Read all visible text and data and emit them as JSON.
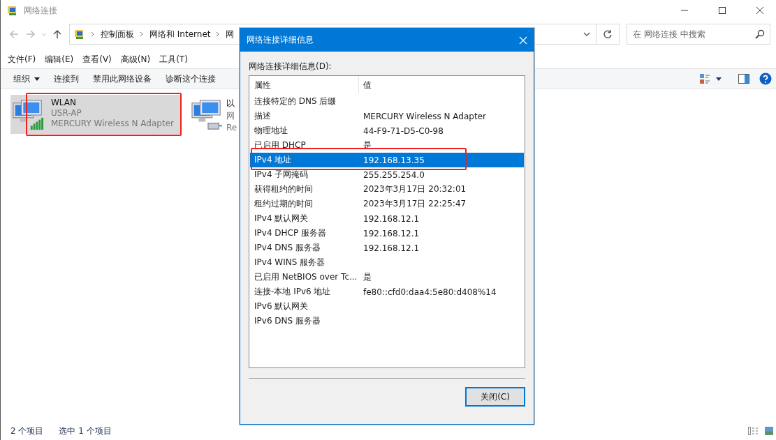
{
  "window": {
    "title": "网络连接"
  },
  "address_bar": {
    "crumbs": [
      "控制面板",
      "网络和 Internet",
      "网"
    ]
  },
  "search": {
    "placeholder": "在 网络连接 中搜索"
  },
  "menu_bar": [
    "文件(F)",
    "编辑(E)",
    "查看(V)",
    "高级(N)",
    "工具(T)"
  ],
  "command_bar": [
    {
      "label": "组织",
      "kind": "dropdown"
    },
    {
      "label": "连接到",
      "kind": "plain"
    },
    {
      "label": "禁用此网络设备",
      "kind": "plain"
    },
    {
      "label": "诊断这个连接",
      "kind": "plain"
    }
  ],
  "adapters": [
    {
      "kind": "wireless",
      "name": "WLAN",
      "network": "USR-AP",
      "device": "MERCURY Wireless N Adapter",
      "selected": true,
      "highlighted": true
    },
    {
      "kind": "ethernet",
      "name": "以",
      "network": "网",
      "device": "Re",
      "selected": false,
      "highlighted": false
    }
  ],
  "status_bar": {
    "count": "2 个项目",
    "selection": "选中 1 个项目"
  },
  "dialog": {
    "title": "网络连接详细信息",
    "list_label": "网络连接详细信息(D):",
    "columns": [
      "属性",
      "值"
    ],
    "rows": [
      {
        "property": "连接特定的 DNS 后缀",
        "value": "",
        "selected": false,
        "highlighted": false
      },
      {
        "property": "描述",
        "value": "MERCURY Wireless N Adapter",
        "selected": false,
        "highlighted": false
      },
      {
        "property": "物理地址",
        "value": "44-F9-71-D5-C0-98",
        "selected": false,
        "highlighted": false
      },
      {
        "property": "已启用 DHCP",
        "value": "是",
        "selected": false,
        "highlighted": false
      },
      {
        "property": "IPv4 地址",
        "value": "192.168.13.35",
        "selected": true,
        "highlighted": true
      },
      {
        "property": "IPv4 子网掩码",
        "value": "255.255.254.0",
        "selected": false,
        "highlighted": false
      },
      {
        "property": "获得租约的时间",
        "value": "2023年3月17日 20:32:01",
        "selected": false,
        "highlighted": false
      },
      {
        "property": "租约过期的时间",
        "value": "2023年3月17日 22:25:47",
        "selected": false,
        "highlighted": false
      },
      {
        "property": "IPv4 默认网关",
        "value": "192.168.12.1",
        "selected": false,
        "highlighted": false
      },
      {
        "property": "IPv4 DHCP 服务器",
        "value": "192.168.12.1",
        "selected": false,
        "highlighted": false
      },
      {
        "property": "IPv4 DNS 服务器",
        "value": "192.168.12.1",
        "selected": false,
        "highlighted": false
      },
      {
        "property": "IPv4 WINS 服务器",
        "value": "",
        "selected": false,
        "highlighted": false
      },
      {
        "property": "已启用 NetBIOS over Tc...",
        "value": "是",
        "selected": false,
        "highlighted": false
      },
      {
        "property": "连接-本地 IPv6 地址",
        "value": "fe80::cfd0:daa4:5e80:d408%14",
        "selected": false,
        "highlighted": false
      },
      {
        "property": "IPv6 默认网关",
        "value": "",
        "selected": false,
        "highlighted": false
      },
      {
        "property": "IPv6 DNS 服务器",
        "value": "",
        "selected": false,
        "highlighted": false
      }
    ],
    "button": "关闭(C)"
  }
}
